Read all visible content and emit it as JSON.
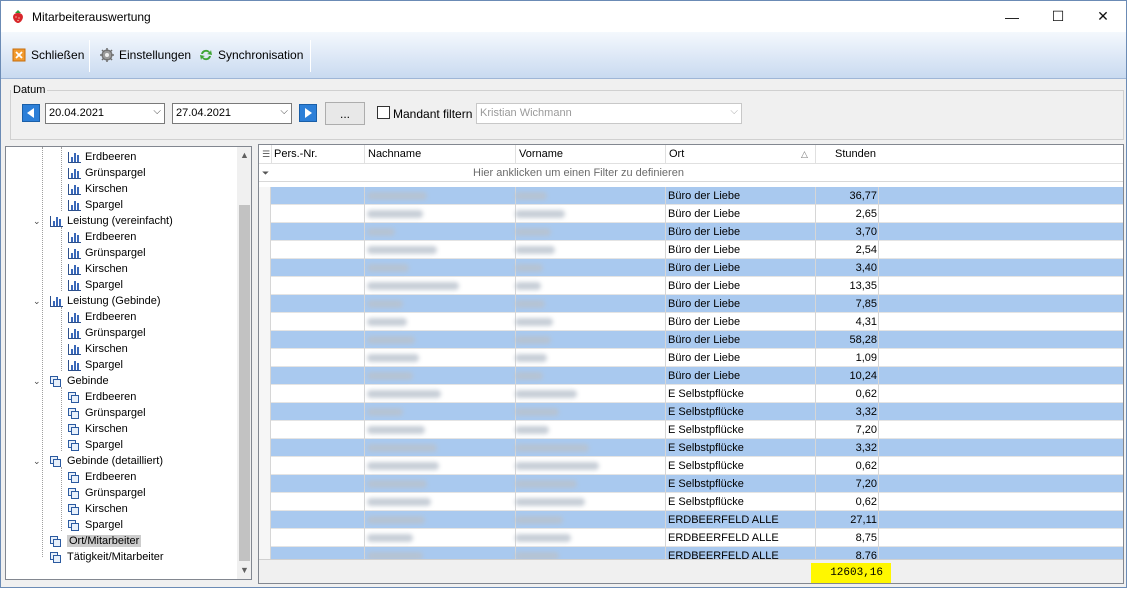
{
  "window": {
    "title": "Mitarbeiterauswertung",
    "controls": {
      "minimize": "—",
      "maximize": "☐",
      "close": "✕"
    }
  },
  "toolbar": {
    "close_label": "Schließen",
    "settings_label": "Einstellungen",
    "sync_label": "Synchronisation"
  },
  "datum": {
    "group_label": "Datum",
    "from_date": "20.04.2021",
    "to_date": "27.04.2021",
    "more_label": "...",
    "mandant_filter_label": "Mandant filtern",
    "mandant_value": "Kristian Wichmann"
  },
  "tree": {
    "items": [
      {
        "label": "Erdbeeren",
        "level": 2,
        "icon": "bar-chart-icon"
      },
      {
        "label": "Grünspargel",
        "level": 2,
        "icon": "bar-chart-icon"
      },
      {
        "label": "Kirschen",
        "level": 2,
        "icon": "bar-chart-icon"
      },
      {
        "label": "Spargel",
        "level": 2,
        "icon": "bar-chart-icon"
      },
      {
        "label": "Leistung (vereinfacht)",
        "level": 1,
        "icon": "bar-chart-icon",
        "expanded": true
      },
      {
        "label": "Erdbeeren",
        "level": 2,
        "icon": "bar-chart-icon"
      },
      {
        "label": "Grünspargel",
        "level": 2,
        "icon": "bar-chart-icon"
      },
      {
        "label": "Kirschen",
        "level": 2,
        "icon": "bar-chart-icon"
      },
      {
        "label": "Spargel",
        "level": 2,
        "icon": "bar-chart-icon"
      },
      {
        "label": "Leistung (Gebinde)",
        "level": 1,
        "icon": "bar-chart-icon",
        "expanded": true
      },
      {
        "label": "Erdbeeren",
        "level": 2,
        "icon": "bar-chart-icon"
      },
      {
        "label": "Grünspargel",
        "level": 2,
        "icon": "bar-chart-icon"
      },
      {
        "label": "Kirschen",
        "level": 2,
        "icon": "bar-chart-icon"
      },
      {
        "label": "Spargel",
        "level": 2,
        "icon": "bar-chart-icon"
      },
      {
        "label": "Gebinde",
        "level": 1,
        "icon": "documents-icon",
        "expanded": true
      },
      {
        "label": "Erdbeeren",
        "level": 2,
        "icon": "documents-icon"
      },
      {
        "label": "Grünspargel",
        "level": 2,
        "icon": "documents-icon"
      },
      {
        "label": "Kirschen",
        "level": 2,
        "icon": "documents-icon"
      },
      {
        "label": "Spargel",
        "level": 2,
        "icon": "documents-icon"
      },
      {
        "label": "Gebinde (detailliert)",
        "level": 1,
        "icon": "documents-icon",
        "expanded": true
      },
      {
        "label": "Erdbeeren",
        "level": 2,
        "icon": "documents-icon"
      },
      {
        "label": "Grünspargel",
        "level": 2,
        "icon": "documents-icon"
      },
      {
        "label": "Kirschen",
        "level": 2,
        "icon": "documents-icon"
      },
      {
        "label": "Spargel",
        "level": 2,
        "icon": "documents-icon"
      },
      {
        "label": "Ort/Mitarbeiter",
        "level": 1,
        "icon": "documents-icon",
        "selected": true
      },
      {
        "label": "Tätigkeit/Mitarbeiter",
        "level": 1,
        "icon": "documents-icon"
      }
    ]
  },
  "grid": {
    "columns": [
      "Pers.-Nr.",
      "Nachname",
      "Vorname",
      "Ort",
      "Stunden"
    ],
    "filter_hint": "Hier anklicken um einen Filter zu definieren",
    "rows": [
      {
        "ort": "Büro der Liebe",
        "stunden": "36,77"
      },
      {
        "ort": "Büro der Liebe",
        "stunden": "2,65"
      },
      {
        "ort": "Büro der Liebe",
        "stunden": "3,70"
      },
      {
        "ort": "Büro der Liebe",
        "stunden": "2,54"
      },
      {
        "ort": "Büro der Liebe",
        "stunden": "3,40"
      },
      {
        "ort": "Büro der Liebe",
        "stunden": "13,35"
      },
      {
        "ort": "Büro der Liebe",
        "stunden": "7,85"
      },
      {
        "ort": "Büro der Liebe",
        "stunden": "4,31"
      },
      {
        "ort": "Büro der Liebe",
        "stunden": "58,28"
      },
      {
        "ort": "Büro der Liebe",
        "stunden": "1,09"
      },
      {
        "ort": "Büro der Liebe",
        "stunden": "10,24"
      },
      {
        "ort": "E Selbstpflücke",
        "stunden": "0,62"
      },
      {
        "ort": "E Selbstpflücke",
        "stunden": "3,32"
      },
      {
        "ort": "E Selbstpflücke",
        "stunden": "7,20"
      },
      {
        "ort": "E Selbstpflücke",
        "stunden": "3,32"
      },
      {
        "ort": "E Selbstpflücke",
        "stunden": "0,62"
      },
      {
        "ort": "E Selbstpflücke",
        "stunden": "7,20"
      },
      {
        "ort": "E Selbstpflücke",
        "stunden": "0,62"
      },
      {
        "ort": "ERDBEERFELD ALLE",
        "stunden": "27,11"
      },
      {
        "ort": "ERDBEERFELD ALLE",
        "stunden": "8,75"
      },
      {
        "ort": "ERDBEERFELD ALLE",
        "stunden": "8,76"
      }
    ],
    "total": "12603,16"
  },
  "colors": {
    "accent": "#2c7fd8",
    "row_alt": "#a9c9ef",
    "highlight": "#fff700"
  }
}
